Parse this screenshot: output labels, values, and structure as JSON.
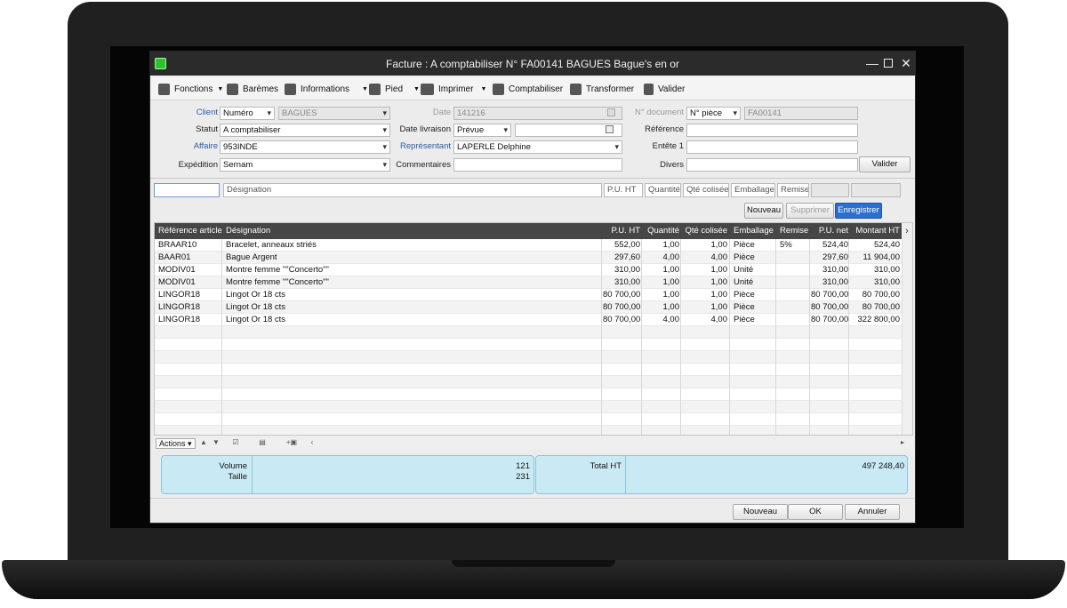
{
  "window": {
    "title": "Facture : A comptabiliser N° FA00141 BAGUES Bague's en or"
  },
  "toolbar": {
    "fonctions": "Fonctions",
    "baremes": "Barèmes",
    "informations": "Informations",
    "pied": "Pied",
    "imprimer": "Imprimer",
    "comptabiliser": "Comptabiliser",
    "transformer": "Transformer",
    "valider": "Valider"
  },
  "form": {
    "client_label": "Client",
    "client_type": "Numéro",
    "client_value": "BAGUES",
    "statut_label": "Statut",
    "statut_value": "A comptabiliser",
    "affaire_label": "Affaire",
    "affaire_value": "953INDE",
    "expedition_label": "Expédition",
    "expedition_value": "Sernam",
    "date_label": "Date",
    "date_value": "141216",
    "date_livraison_label": "Date livraison",
    "date_livraison_value": "Prévue",
    "representant_label": "Représentant",
    "representant_value": "LAPERLE Delphine",
    "commentaires_label": "Commentaires",
    "no_document_label": "N° document",
    "no_document_type": "N° pièce",
    "no_document_value": "FA00141",
    "reference_label": "Référence",
    "entete_label": "Entête 1",
    "divers_label": "Divers",
    "valider_button": "Valider"
  },
  "entry": {
    "designation": "Désignation",
    "pu_ht": "P.U. HT",
    "quantite": "Quantité",
    "qte_colisee": "Qté colisée",
    "emballage": "Emballage",
    "remise": "Remise"
  },
  "grid_actions": {
    "nouveau": "Nouveau",
    "supprimer": "Supprimer",
    "enregistrer": "Enregistrer"
  },
  "table": {
    "headers": [
      "Référence article",
      "Désignation",
      "P.U. HT",
      "Quantité",
      "Qté colisée",
      "Emballage",
      "Remise",
      "P.U. net",
      "Montant HT"
    ],
    "rows": [
      [
        "BRAAR10",
        "Bracelet, anneaux striés",
        "552,00",
        "1,00",
        "1,00",
        "Pièce",
        "5%",
        "524,40",
        "524,40"
      ],
      [
        "BAAR01",
        "Bague Argent",
        "297,60",
        "4,00",
        "4,00",
        "Pièce",
        "",
        "297,60",
        "11 904,00"
      ],
      [
        "MODIV01",
        "Montre femme \"\"Concerto\"\"",
        "310,00",
        "1,00",
        "1,00",
        "Unité",
        "",
        "310,00",
        "310,00"
      ],
      [
        "MODIV01",
        "Montre femme \"\"Concerto\"\"",
        "310,00",
        "1,00",
        "1,00",
        "Unité",
        "",
        "310,00",
        "310,00"
      ],
      [
        "LINGOR18",
        "Lingot Or 18 cts",
        "80 700,00",
        "1,00",
        "1,00",
        "Pièce",
        "",
        "80 700,00",
        "80 700,00"
      ],
      [
        "LINGOR18",
        "Lingot Or 18 cts",
        "80 700,00",
        "1,00",
        "1,00",
        "Pièce",
        "",
        "80 700,00",
        "80 700,00"
      ],
      [
        "LINGOR18",
        "Lingot Or 18 cts",
        "80 700,00",
        "4,00",
        "4,00",
        "Pièce",
        "",
        "80 700,00",
        "322 800,00"
      ]
    ]
  },
  "grid_footer": {
    "actions": "Actions"
  },
  "totals": {
    "volume_label": "Volume",
    "volume_value": "121",
    "taille_label": "Taille",
    "taille_value": "231",
    "total_ht_label": "Total HT",
    "total_ht_value": "497 248,40"
  },
  "bottom": {
    "nouveau": "Nouveau",
    "ok": "OK",
    "annuler": "Annuler"
  }
}
